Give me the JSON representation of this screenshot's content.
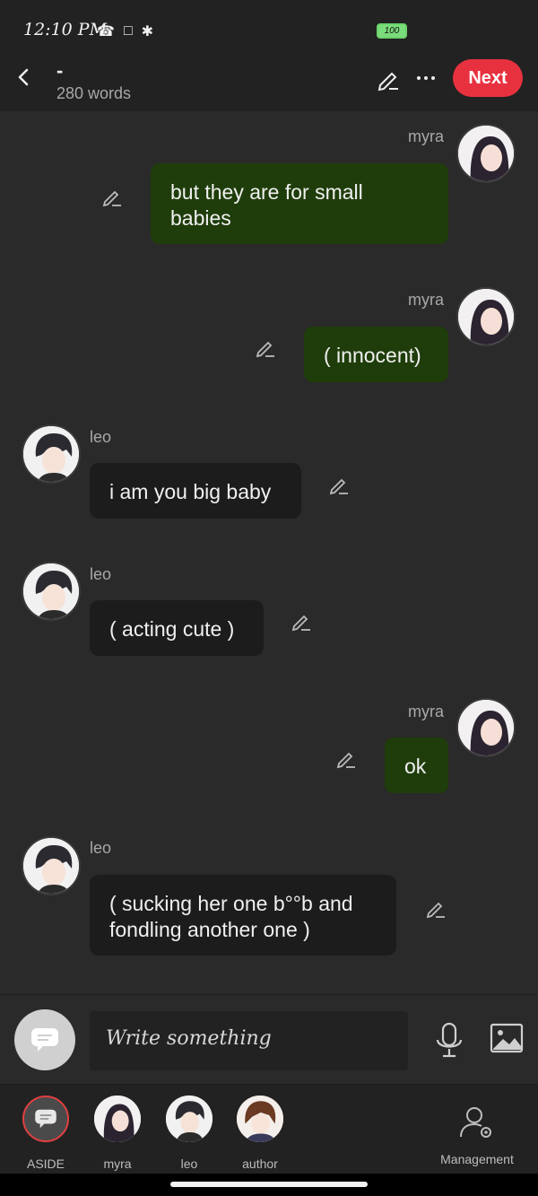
{
  "status": {
    "time": "12:10 PM",
    "battery": "100"
  },
  "header": {
    "title": "-",
    "word_count": "280 words",
    "next_label": "Next"
  },
  "messages": [
    {
      "speaker": "myra",
      "text": "but they are for small babies",
      "side": "right"
    },
    {
      "speaker": "myra",
      "text": "( innocent)",
      "side": "right"
    },
    {
      "speaker": "leo",
      "text": "i am you big baby",
      "side": "left"
    },
    {
      "speaker": "leo",
      "text": "( acting cute )",
      "side": "left"
    },
    {
      "speaker": "myra",
      "text": "ok",
      "side": "right"
    },
    {
      "speaker": "leo",
      "text": "( sucking her one b°°b and fondling another one )",
      "side": "left"
    }
  ],
  "input": {
    "placeholder": "Write something"
  },
  "characters": [
    {
      "label": "ASIDE"
    },
    {
      "label": "myra"
    },
    {
      "label": "leo"
    },
    {
      "label": "author"
    }
  ],
  "management": {
    "label": "Management"
  },
  "colors": {
    "accent": "#e8313f",
    "right_bubble": "#1f3d0a",
    "left_bubble": "#1c1c1c",
    "background": "#2a2a2a"
  }
}
